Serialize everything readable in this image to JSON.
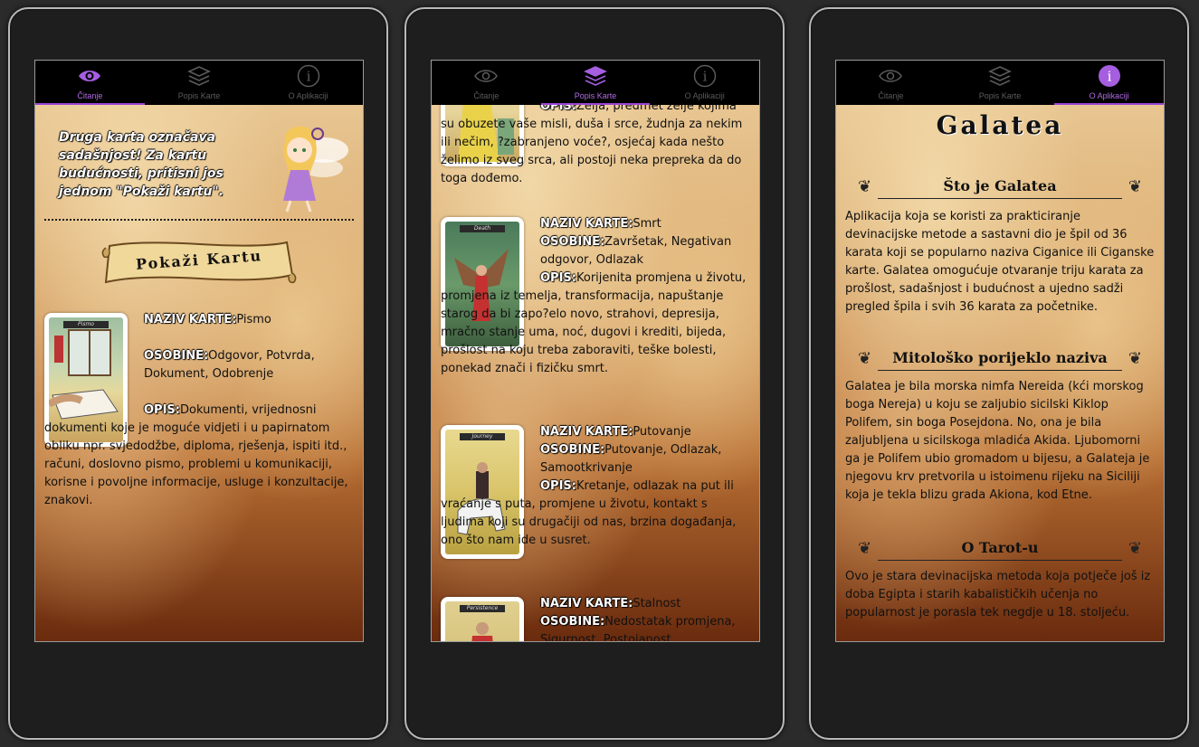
{
  "tabs": {
    "reading": "Čitanje",
    "card_list": "Popis Karte",
    "about": "O Aplikaciji"
  },
  "screen1": {
    "instruction": "Druga karta označava sadašnjost! Za kartu budućnosti, pritisni jos jednom \"Pokaži kartu\".",
    "button_label": "Pokaži Kartu",
    "card_caption": "Pismo",
    "name_label": "NAZIV KARTE:",
    "name_value": "Pismo",
    "attr_label": "OSOBINE:",
    "attr_value": "Odgovor, Potvrda, Dokument, Odobrenje",
    "desc_label": "OPIS:",
    "desc_value": "Dokumenti, vrijednosni dokumenti koje je moguće vidjeti i u papirnatom obliku npr. svjedodžbe, diploma, rješenja, ispiti itd., računi, doslovno pismo, problemi u komunikaciji, korisne i povoljne informacije, usluge i konzultacije, znakovi."
  },
  "screen2": {
    "top_text_label": "OPIS:",
    "top_text": "Želja, predmet želje kojima su obuzete vaše misli, duša i srce, žudnja za nekim ili nečim, ?zabranjeno voće?, osjećaj kada nešto želimo iz sveg srca, ali postoji neka prepreka da do toga dođemo.",
    "cards": [
      {
        "caption": "Death",
        "name_label": "NAZIV KARTE:",
        "name": "Smrt",
        "attr_label": "OSOBINE:",
        "attrs": "Završetak, Negativan odgovor, Odlazak",
        "desc_label": "OPIS:",
        "desc": "Korijenita promjena u životu, promjena iz temelja, transformacija, napuštanje starog da bi zapo?elo novo, strahovi, depresija, mračno stanje uma, noć, dugovi i krediti, bijeda, prošlost na koju treba zaboraviti, teške bolesti, ponekad znači i fizičku smrt."
      },
      {
        "caption": "Journey",
        "name_label": "NAZIV KARTE:",
        "name": "Putovanje",
        "attr_label": "OSOBINE:",
        "attrs": "Putovanje, Odlazak, Samootkrivanje",
        "desc_label": "OPIS:",
        "desc": "Kretanje, odlazak na put ili vraćanje s puta, promjene u životu, kontakt s ljudima koji su drugačiji od nas, brzina događanja, ono što nam ide u susret."
      },
      {
        "caption": "Persistence",
        "name_label": "NAZIV KARTE:",
        "name": "Stalnost",
        "attr_label": "OSOBINE:",
        "attrs": "Nedostatak promjena, Sigurnost, Postojanost"
      }
    ]
  },
  "screen3": {
    "title": "Galatea",
    "sections": [
      {
        "heading": "Što je Galatea",
        "text": "Aplikacija koja se koristi za prakticiranje devinacijske metode a sastavni dio je špil od 36 karata koji se popularno naziva Ciganice ili Ciganske karte. Galatea omogućuje otvaranje triju karata za prošlost, sadašnjost i budućnost a ujedno sadži pregled špila i svih 36 karata za početnike."
      },
      {
        "heading": "Mitološko porijeklo naziva",
        "text": "Galatea je bila morska nimfa Nereida (kći morskog boga Nereja) u koju se zaljubio sicilski Kiklop Polifem, sin boga Posejdona. No, ona je bila zaljubljena u sicilskoga mladića Akida. Ljubomorni ga je Polifem ubio gromadom u bijesu, a Galateja je njegovu krv pretvorila u istoimenu rijeku na Siciliji koja je tekla blizu grada Akiona, kod Etne."
      },
      {
        "heading": "O Tarot-u",
        "text": "Ovo je stara devinacijska metoda koja potječe još iz doba Egipta i starih kabalističkih učenja no popularnost je porasla tek negdje u 18. stoljeću."
      }
    ]
  },
  "colors": {
    "accent": "#9b45d6",
    "inactive": "#5b5b5b"
  }
}
